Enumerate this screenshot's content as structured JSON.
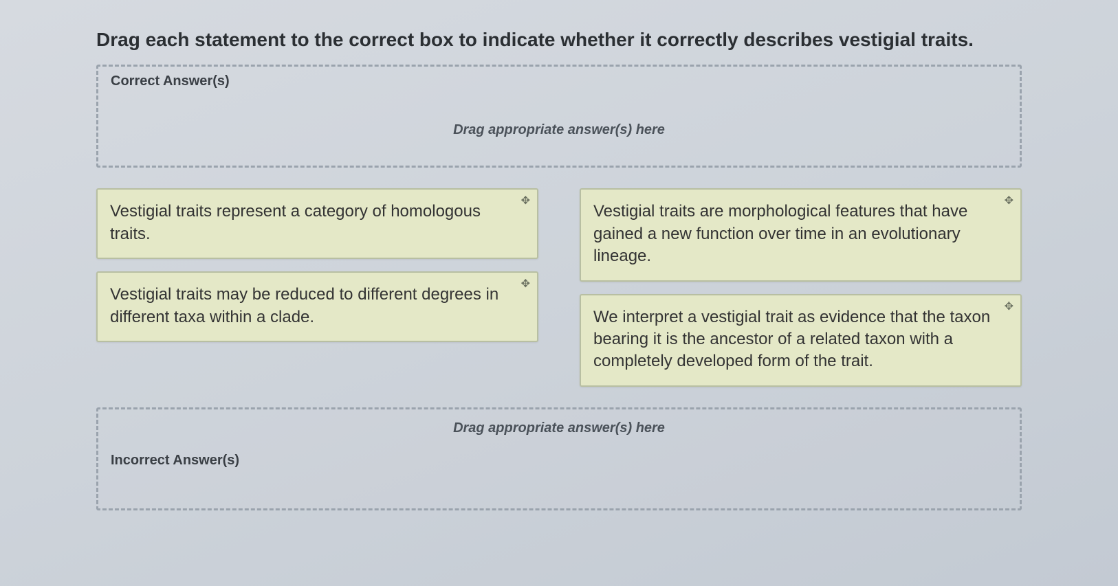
{
  "prompt": "Drag each statement to the correct box to indicate whether it correctly describes vestigial traits.",
  "zones": {
    "correct": {
      "label": "Correct Answer(s)",
      "placeholder": "Drag appropriate answer(s) here"
    },
    "incorrect": {
      "label": "Incorrect Answer(s)",
      "placeholder": "Drag appropriate answer(s) here"
    }
  },
  "cards": {
    "c1": "Vestigial traits represent a category of homologous traits.",
    "c2": "Vestigial traits may be reduced to different degrees in different taxa within a clade.",
    "c3": "Vestigial traits are morphological features that have gained a new function over time in an evolutionary lineage.",
    "c4": "We interpret a vestigial trait as evidence that the taxon bearing it is the ancestor of a related taxon with a completely developed form of the trait."
  },
  "icons": {
    "move": "✥"
  }
}
